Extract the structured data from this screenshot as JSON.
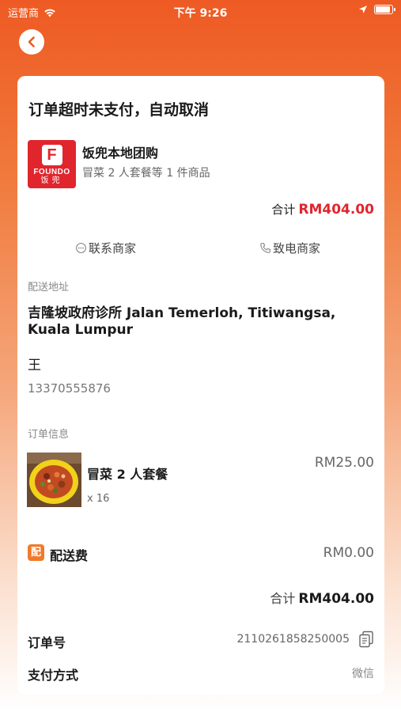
{
  "status_bar": {
    "carrier": "运营商",
    "time": "下午 9:26",
    "battery_level": 0.95
  },
  "header": {
    "back_icon": "chevron-left-icon"
  },
  "order": {
    "status_title": "订单超时未支付，自动取消",
    "shop": {
      "name": "饭兜本地团购",
      "items_summary": "冒菜 2 人套餐等 1 件商品",
      "logo_text_en": "FOUNDO",
      "logo_text_cn": "饭兜",
      "logo_color": "#e0252d"
    },
    "total_label": "合计",
    "total_amount": "RM404.00",
    "accent_color": "#e0252d",
    "actions": {
      "contact_merchant": "联系商家",
      "call_merchant": "致电商家"
    }
  },
  "delivery": {
    "section_label": "配送地址",
    "address": "吉隆坡政府诊所 Jalan Temerloh, Titiwangsa, Kuala Lumpur",
    "recipient": "王",
    "phone": "13370555876"
  },
  "order_info": {
    "section_label": "订单信息",
    "product": {
      "name": "冒菜 2 人套餐",
      "quantity": "x 16",
      "price": "RM25.00"
    },
    "delivery_fee_icon": "配",
    "delivery_fee_label": "配送费",
    "delivery_fee_value": "RM0.00",
    "total_label": "合计",
    "total_amount": "RM404.00",
    "order_no_label": "订单号",
    "order_no": "2110261858250005",
    "payment_label": "支付方式",
    "payment_method": "微信"
  }
}
